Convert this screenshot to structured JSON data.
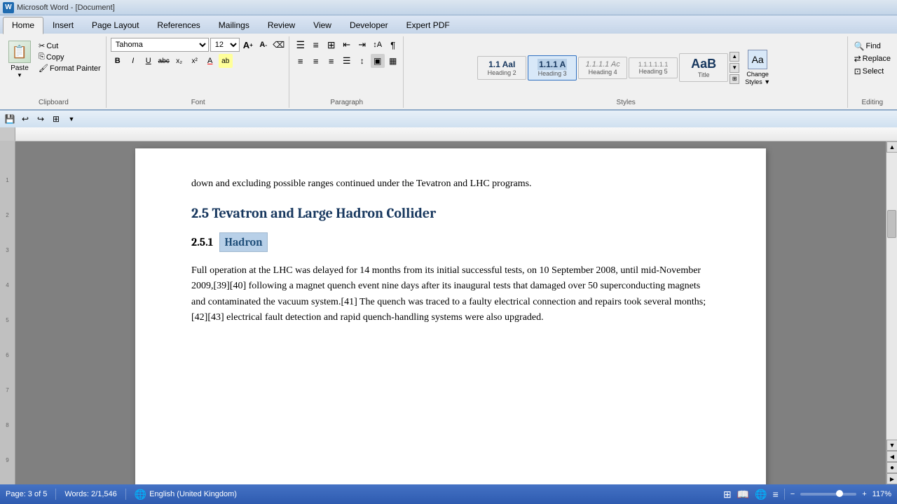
{
  "titlebar": {
    "icon": "W",
    "title": "Microsoft Word"
  },
  "ribbon": {
    "tabs": [
      "Home",
      "Insert",
      "Page Layout",
      "References",
      "Mailings",
      "Review",
      "View",
      "Developer",
      "Expert PDF"
    ],
    "active_tab": "Home",
    "groups": {
      "clipboard": {
        "label": "Clipboard",
        "paste_label": "Paste",
        "cut_label": "Cut",
        "copy_label": "Copy",
        "format_painter_label": "Format Painter"
      },
      "font": {
        "label": "Font",
        "font_name": "Tahoma",
        "font_size": "12",
        "bold": "B",
        "italic": "I",
        "underline": "U",
        "strikethrough": "abc",
        "subscript": "x₂",
        "superscript": "x²",
        "font_color": "A",
        "highlight": "ab"
      },
      "paragraph": {
        "label": "Paragraph"
      },
      "styles": {
        "label": "Styles",
        "items": [
          {
            "id": "heading2",
            "preview": "1.1 AaI",
            "label": "Heading 2",
            "active": false
          },
          {
            "id": "heading3",
            "preview": "1.1.1 A",
            "label": "Heading 3",
            "active": true
          },
          {
            "id": "heading4",
            "preview": "1.1.1.1 Ac",
            "label": "Heading 4",
            "active": false
          },
          {
            "id": "heading5",
            "preview": "1.1.1.1.1.1",
            "label": "Heading 5",
            "active": false
          },
          {
            "id": "title",
            "preview": "AaB",
            "label": "Title",
            "active": false
          }
        ],
        "change_styles_label": "Change\nStyles"
      },
      "editing": {
        "label": "Editing",
        "find_label": "Find",
        "replace_label": "Replace",
        "select_label": "Select"
      }
    }
  },
  "quickaccess": {
    "buttons": [
      "💾",
      "↩",
      "↪",
      "⊞",
      "▼"
    ]
  },
  "document": {
    "intro_text": "down and excluding possible ranges continued under the Tevatron and LHC programs.",
    "section_2_5_number": "2.5",
    "section_2_5_title": "Tevatron and Large Hadron Collider",
    "section_2_5_1_number": "2.5.1",
    "section_2_5_1_title_highlighted": "Hadron",
    "paragraph": "Full operation at the LHC was delayed for 14 months from its initial successful tests, on 10 September 2008, until mid-November 2009,[39][40] following a magnet quench event nine days after its inaugural tests that damaged over 50 superconducting magnets and contaminated the vacuum system.[41] The quench was traced to a faulty electrical connection and repairs took several months;[42][43] electrical fault detection and rapid quench-handling systems were also upgraded."
  },
  "statusbar": {
    "page": "Page: 3 of 5",
    "words": "Words: 2/1,546",
    "language": "English (United Kingdom)",
    "zoom_level": "117%",
    "zoom_minus": "−",
    "zoom_plus": "+"
  }
}
